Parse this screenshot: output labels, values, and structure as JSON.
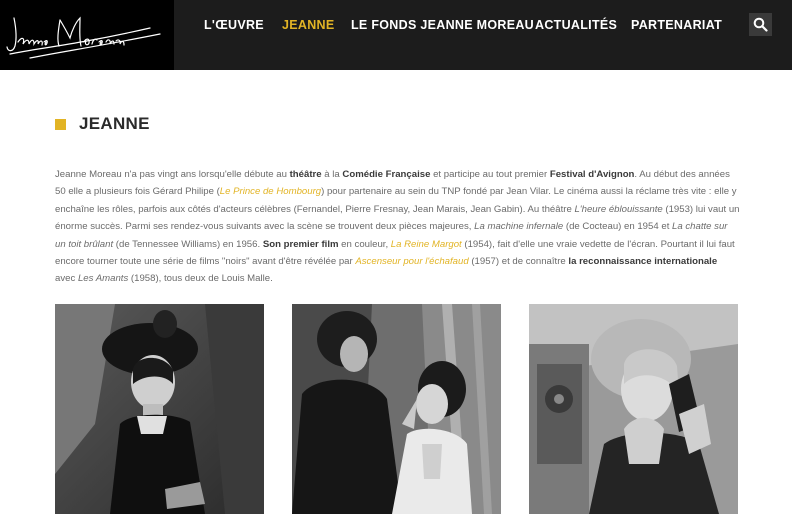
{
  "colors": {
    "accent": "#e2b425",
    "nav_bg": "#1c1c1c",
    "logo_bg": "#000000",
    "text": "#6b6b6b",
    "title": "#2b2b2b"
  },
  "logo": {
    "signature": "Jeanne Moreau"
  },
  "nav": {
    "items": [
      {
        "label": "L'ŒUVRE",
        "active": false
      },
      {
        "label": "JEANNE",
        "active": true
      },
      {
        "label": "LE FONDS JEANNE MOREAU",
        "active": false
      },
      {
        "label": "ACTUALITÉS",
        "active": false
      },
      {
        "label": "PARTENARIAT",
        "active": false
      }
    ],
    "search_icon": "search-icon"
  },
  "page": {
    "title": "JEANNE"
  },
  "intro": {
    "t01": "Jeanne Moreau n'a pas vingt ans lorsqu'elle débute au ",
    "b01": "théâtre",
    "t02": " à la ",
    "b02": "Comédie Française",
    "t03": " et participe au tout premier ",
    "b03": "Festival d'Avignon",
    "t04": ". Au début des années 50 elle a plusieurs fois Gérard Philipe (",
    "l01": "Le Prince de Hombourg",
    "t05": ") pour partenaire au sein du TNP fondé par Jean Vilar. Le cinéma aussi la réclame très vite : elle y enchaîne les rôles, parfois aux côtés d'acteurs célèbres (Fernandel, Pierre Fresnay, Jean Marais, Jean Gabin). Au théâtre ",
    "i01": "L'heure éblouissante",
    "t06": " (1953) lui vaut un énorme succès. Parmi ses rendez-vous suivants avec la scène se trouvent deux pièces majeures, ",
    "i02": "La machine infernale",
    "t07": " (de Cocteau) en 1954 et ",
    "i03": "La chatte sur un toit brûlant",
    "t08": " (de Tennessee Williams) en 1956. ",
    "b04": "Son premier film",
    "t09": " en couleur, ",
    "l02": "La Reine Margot",
    "t10": " (1954), fait d'elle une vraie vedette de l'écran. Pourtant il lui faut encore tourner toute une série de films \"noirs\" avant d'être révélée par ",
    "l03": "Ascenseur pour l'échafaud",
    "t11": " (1957) et de connaître ",
    "b05": "la reconnaissance internationale",
    "t12": " avec ",
    "i04": "Les Amants",
    "t13": " (1958), tous deux de Louis Malle."
  },
  "photos": [
    {
      "name": "photo-woman-in-hat"
    },
    {
      "name": "photo-two-women"
    },
    {
      "name": "photo-woman-on-phone"
    }
  ]
}
